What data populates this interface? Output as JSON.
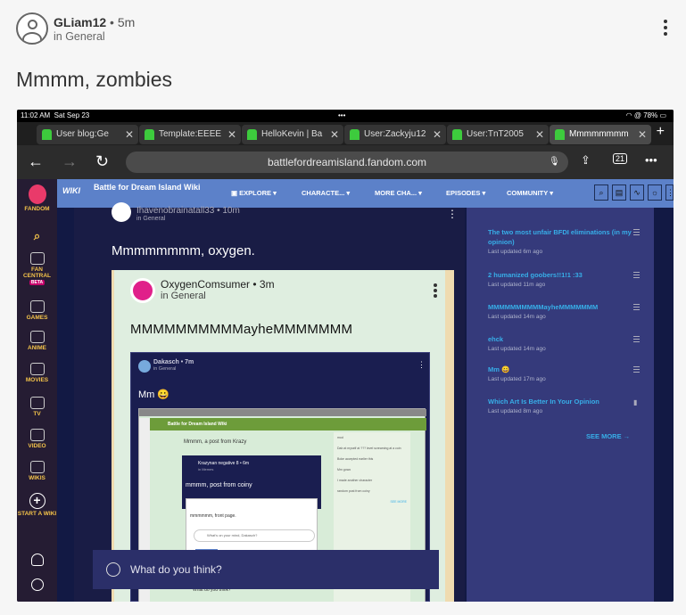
{
  "post": {
    "username": "GLiam12",
    "time": "5m",
    "category": "in General",
    "title": "Mmmm, zombies"
  },
  "screenshot": {
    "status": {
      "time": "11:02 AM",
      "date": "Sat Sep 23",
      "dots": "•••",
      "battery": "78%"
    },
    "tabs": [
      "User blog:Ge",
      "Template:EEEE",
      "HelloKevin | Ba",
      "User:Zackyju12",
      "User:TnT2005",
      "Mmmmmmmm"
    ],
    "url": "battlefordreamisland.fandom.com",
    "tab_count": "21",
    "rail": [
      "FANDOM",
      "FAN CENTRAL",
      "BETA",
      "GAMES",
      "ANIME",
      "MOVIES",
      "TV",
      "VIDEO",
      "WIKIS",
      "START A WIKI"
    ],
    "wiki": {
      "logo": "WIKI",
      "name": "Battle for Dream Island Wiki",
      "nav": [
        "EXPLORE",
        "CHARACTE...",
        "MORE CHA...",
        "EPISODES",
        "COMMUNITY"
      ]
    },
    "feed": {
      "author": "Ihavenobrainatall33",
      "time": "10m",
      "category": "in General",
      "title": "Mmmmmmmm, oxygen.",
      "card": {
        "author": "OxygenComsumer",
        "time": "3m",
        "category": "in General",
        "title": "MMMMMMMMMMayheMMMMMMM",
        "inner": {
          "author": "Dakasch",
          "time": "7m",
          "category": "in General",
          "title": "Mm 😀",
          "nested": {
            "wiki": "Battle for Dream Island Wiki",
            "title": "Mmmm, a post from Krazy",
            "sub_author": "Krazynan negative 8",
            "sub_time": "6m",
            "sub_cat": "in Memes",
            "sub_title": "mmmm, post from coiny",
            "sub2": "mmmmmm, front page.",
            "prompt": "What's on your mind, Dakasch?",
            "tag": "Categories",
            "side": [
              "mod",
              "Dab at myself at ??? level screaming at a coin",
              "Boke accepted earlier this",
              "Mm gowo",
              "I made another character",
              "random post from coiny"
            ],
            "more": "SEE MORE"
          }
        }
      }
    },
    "compose": "What do you think?",
    "nested_compose": "What do you think?",
    "side": [
      {
        "title": "The two most unfair BFDI eliminations (in my opinion)",
        "sub": "Last updated 6m ago"
      },
      {
        "title": "2 humanized goobers!!1!1 :33",
        "sub": "Last updated 11m ago"
      },
      {
        "title": "MMMMMMMMMMayheMMMMMMM",
        "sub": "Last updated 14m ago"
      },
      {
        "title": "ehck",
        "sub": "Last updated 14m ago"
      },
      {
        "title": "Mm 😀",
        "sub": "Last updated 17m ago"
      },
      {
        "title": "Which Art Is Better In Your Opinion",
        "sub": "Last updated 8m ago"
      }
    ],
    "see_more": "SEE MORE"
  }
}
